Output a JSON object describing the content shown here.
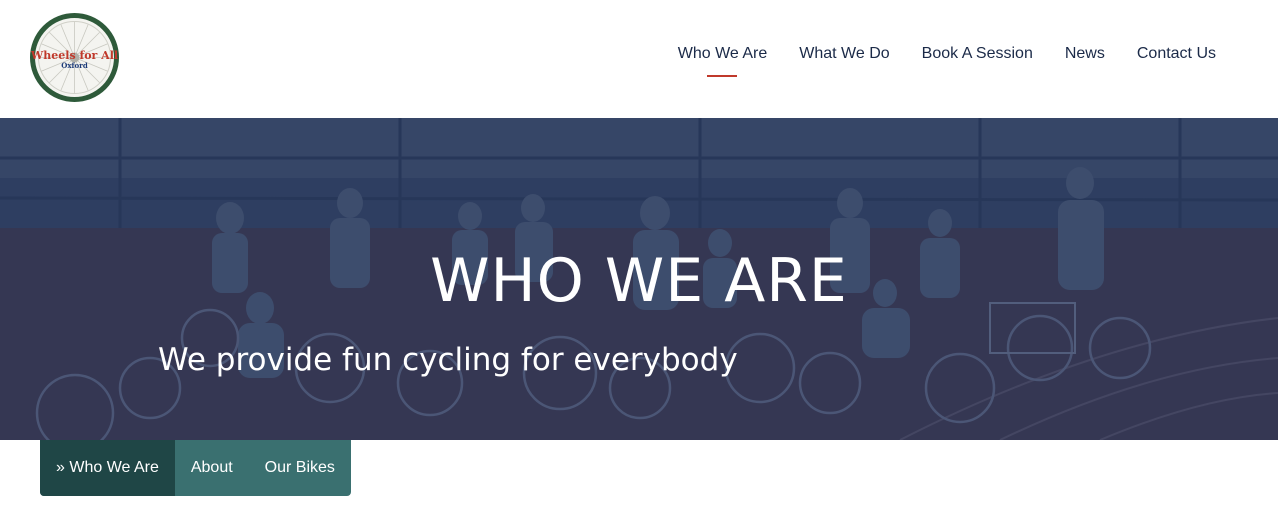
{
  "logo": {
    "line1": "Wheels for All",
    "line2": "Oxford"
  },
  "nav": {
    "items": [
      {
        "label": "Who We Are",
        "active": true
      },
      {
        "label": "What We Do"
      },
      {
        "label": "Book A Session"
      },
      {
        "label": "News"
      },
      {
        "label": "Contact Us"
      }
    ]
  },
  "hero": {
    "title": "WHO WE ARE",
    "subtitle": "We provide fun cycling for everybody"
  },
  "subnav": {
    "items": [
      {
        "label": "» Who We Are",
        "active": true
      },
      {
        "label": "About"
      },
      {
        "label": "Our Bikes"
      }
    ]
  },
  "colors": {
    "accent_underline": "#c0392b",
    "nav_text": "#1b2a48",
    "hero_overlay": "#18284e",
    "subnav_bg": "#3a7070",
    "subnav_active_bg": "#1f4646",
    "logo_ring": "#2e5a3a",
    "logo_text_red": "#c0392b",
    "logo_text_blue": "#1b3a78"
  }
}
